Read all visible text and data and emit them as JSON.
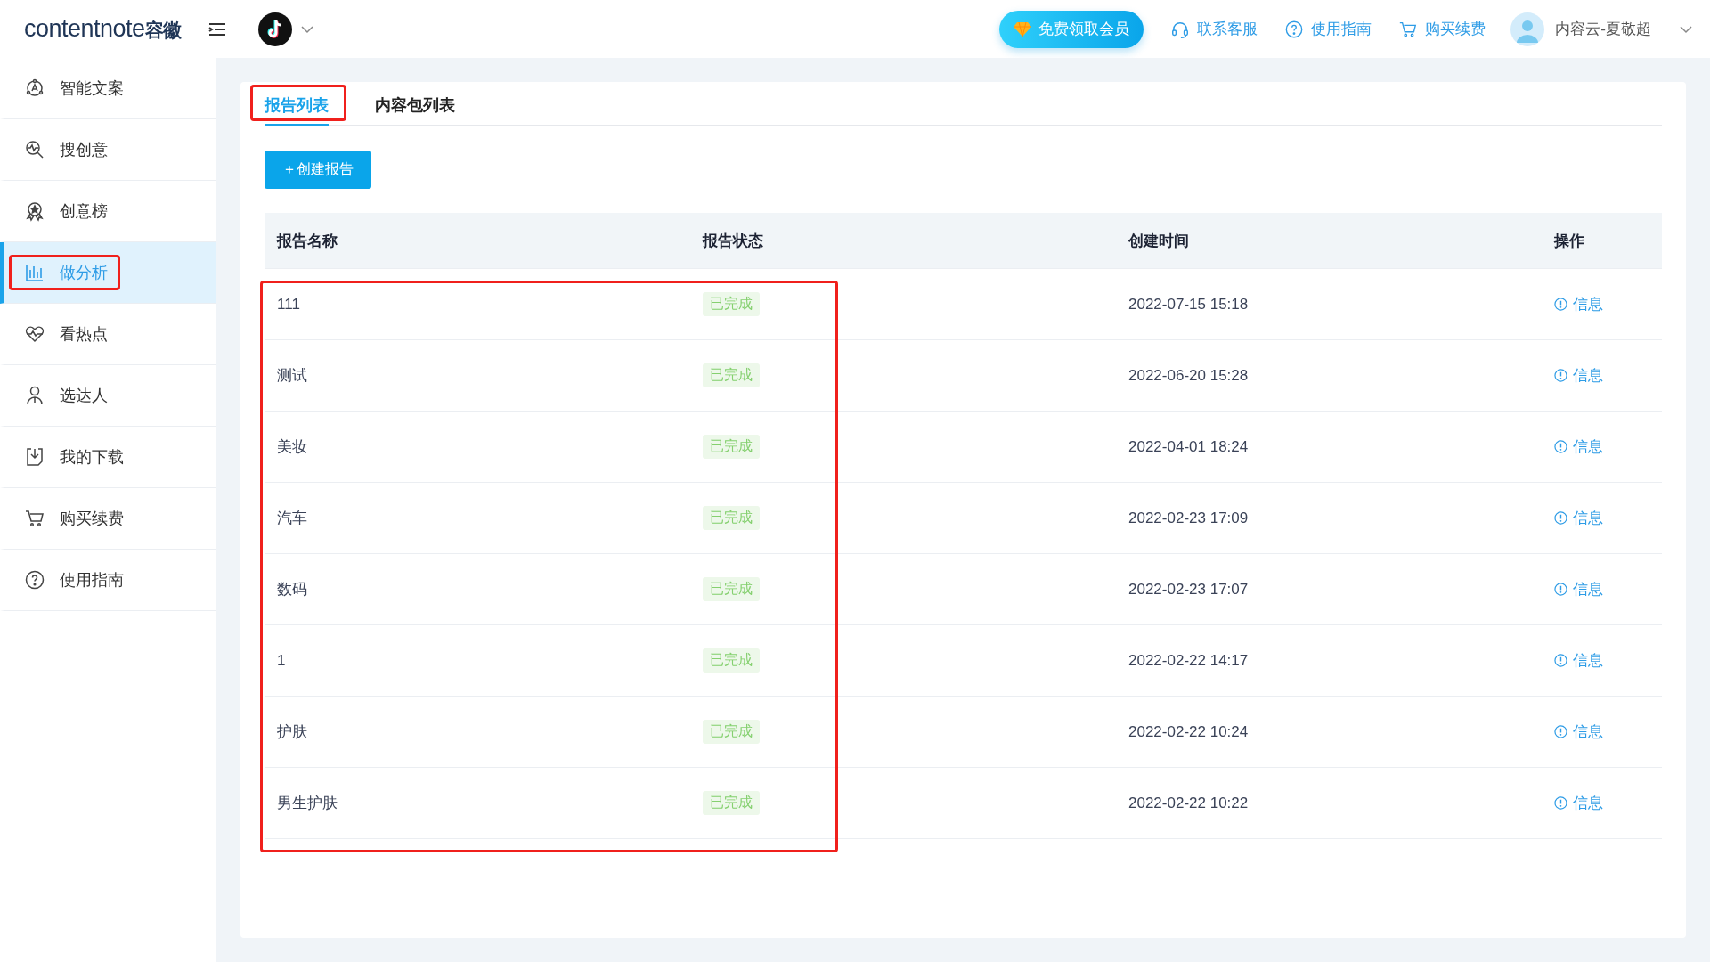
{
  "header": {
    "logo": {
      "latin": "contentnote",
      "chinese": "容徽"
    },
    "vip_button": "免费领取会员",
    "links": [
      {
        "kind": "headset",
        "label": "联系客服"
      },
      {
        "kind": "help",
        "label": "使用指南"
      },
      {
        "kind": "cart",
        "label": "购买续费"
      }
    ],
    "user": "内容云-夏敬超"
  },
  "sidebar": {
    "items": [
      {
        "kind": "copy",
        "label": "智能文案",
        "selected": false,
        "highlighted": false
      },
      {
        "kind": "search",
        "label": "搜创意",
        "selected": false,
        "highlighted": false
      },
      {
        "kind": "award",
        "label": "创意榜",
        "selected": false,
        "highlighted": false
      },
      {
        "kind": "chart",
        "label": "做分析",
        "selected": true,
        "highlighted": true
      },
      {
        "kind": "heart",
        "label": "看热点",
        "selected": false,
        "highlighted": false
      },
      {
        "kind": "person",
        "label": "选达人",
        "selected": false,
        "highlighted": false
      },
      {
        "kind": "download",
        "label": "我的下载",
        "selected": false,
        "highlighted": false
      },
      {
        "kind": "cart",
        "label": "购买续费",
        "selected": false,
        "highlighted": false
      },
      {
        "kind": "help",
        "label": "使用指南",
        "selected": false,
        "highlighted": false
      }
    ]
  },
  "tabs": [
    {
      "label": "报告列表",
      "selected": true,
      "highlighted": true
    },
    {
      "label": "内容包列表",
      "selected": false,
      "highlighted": false
    }
  ],
  "create_button": "＋创建报告",
  "table": {
    "columns": [
      "报告名称",
      "报告状态",
      "创建时间",
      "操作"
    ],
    "highlight_name_status": true,
    "rows": [
      {
        "name": "111",
        "status": "已完成",
        "created": "2022-07-15 15:18",
        "action": "信息"
      },
      {
        "name": "测试",
        "status": "已完成",
        "created": "2022-06-20 15:28",
        "action": "信息"
      },
      {
        "name": "美妆",
        "status": "已完成",
        "created": "2022-04-01 18:24",
        "action": "信息"
      },
      {
        "name": "汽车",
        "status": "已完成",
        "created": "2022-02-23 17:09",
        "action": "信息"
      },
      {
        "name": "数码",
        "status": "已完成",
        "created": "2022-02-23 17:07",
        "action": "信息"
      },
      {
        "name": "1",
        "status": "已完成",
        "created": "2022-02-22 14:17",
        "action": "信息"
      },
      {
        "name": "护肤",
        "status": "已完成",
        "created": "2022-02-22 10:24",
        "action": "信息"
      },
      {
        "name": "男生护肤",
        "status": "已完成",
        "created": "2022-02-22 10:22",
        "action": "信息"
      }
    ]
  }
}
